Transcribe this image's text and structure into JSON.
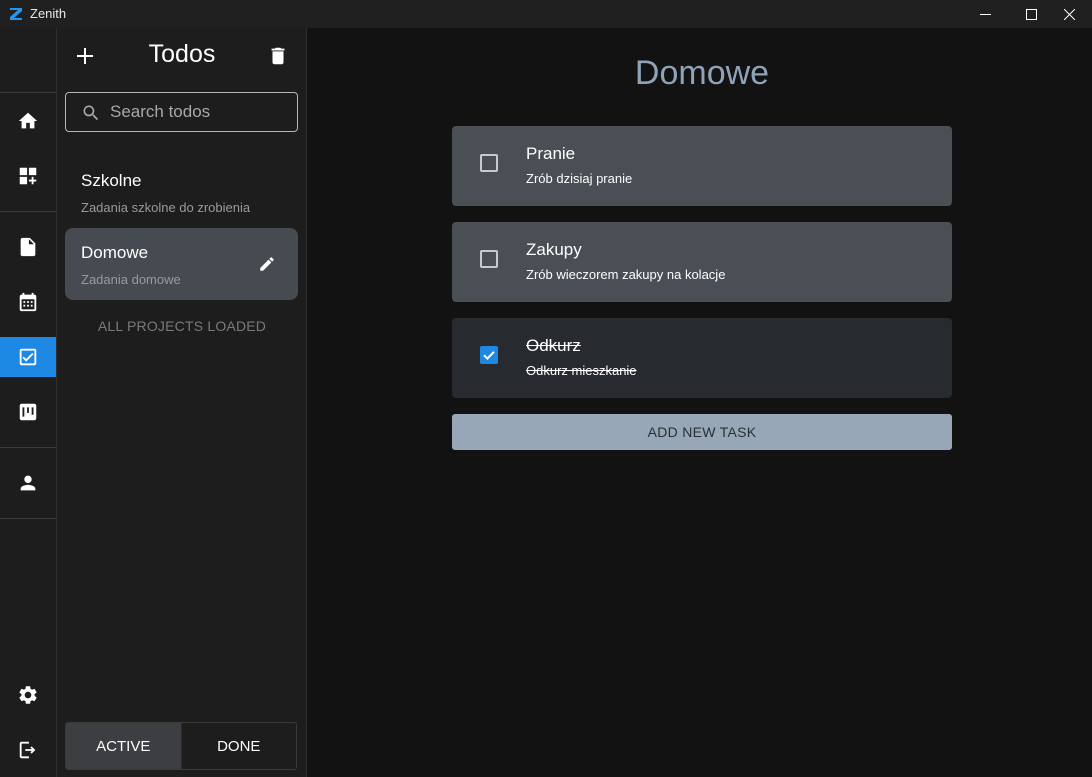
{
  "window": {
    "title": "Zenith",
    "logo_icon": "zenith-logo-icon",
    "accent": "#1e88e5"
  },
  "rail": {
    "items": [
      {
        "name": "home",
        "icon": "home-icon"
      },
      {
        "name": "dashboard-add",
        "icon": "dashboard-add-icon"
      },
      {
        "name": "notes",
        "icon": "document-icon"
      },
      {
        "name": "calendar",
        "icon": "calendar-icon"
      },
      {
        "name": "todos",
        "icon": "checkbox-icon",
        "active": true
      },
      {
        "name": "kanban",
        "icon": "kanban-icon"
      },
      {
        "name": "profile",
        "icon": "person-icon"
      },
      {
        "name": "settings",
        "icon": "gear-icon"
      },
      {
        "name": "logout",
        "icon": "logout-icon"
      }
    ]
  },
  "panel": {
    "title": "Todos",
    "search": {
      "placeholder": "Search todos",
      "value": ""
    },
    "projects": [
      {
        "name": "Szkolne",
        "description": "Zadania szkolne do zrobienia",
        "selected": false
      },
      {
        "name": "Domowe",
        "description": "Zadania domowe",
        "selected": true
      }
    ],
    "all_loaded_label": "ALL PROJECTS LOADED",
    "filters": {
      "active_label": "ACTIVE",
      "done_label": "DONE",
      "selected": "ACTIVE"
    }
  },
  "main": {
    "title": "Domowe",
    "tasks": [
      {
        "title": "Pranie",
        "description": "Zrób dzisiaj pranie",
        "done": false
      },
      {
        "title": "Zakupy",
        "description": "Zrób wieczorem zakupy na kolacje",
        "done": false
      },
      {
        "title": "Odkurz",
        "description": "Odkurz mieszkanie",
        "done": true
      }
    ],
    "add_task_label": "ADD NEW TASK"
  }
}
